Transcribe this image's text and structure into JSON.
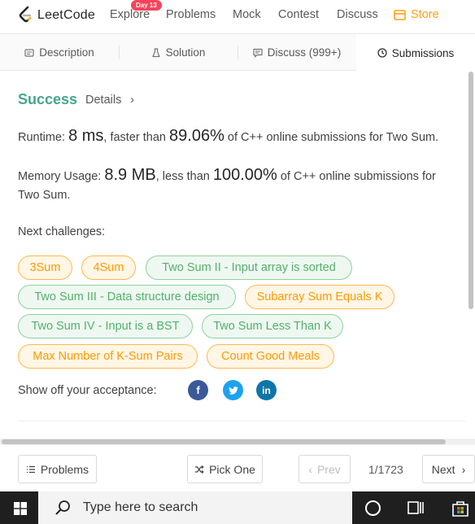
{
  "nav": {
    "logo_text": "LeetCode",
    "explore": "Explore",
    "explore_badge": "Day 13",
    "problems": "Problems",
    "mock": "Mock",
    "contest": "Contest",
    "discuss": "Discuss",
    "store": "Store",
    "accent_color": "#ffa116"
  },
  "tabs": [
    {
      "label": "Description",
      "icon": "document-icon"
    },
    {
      "label": "Solution",
      "icon": "flask-icon"
    },
    {
      "label": "Discuss (999+)",
      "icon": "comment-icon"
    },
    {
      "label": "Submissions",
      "icon": "clock-icon",
      "active": true
    }
  ],
  "result": {
    "status": "Success",
    "status_color": "#45a68c",
    "details": "Details",
    "runtime_label": "Runtime:",
    "runtime_value": "8 ms",
    "runtime_mid": ", faster than",
    "runtime_pct": "89.06%",
    "runtime_tail": "of C++ online submissions for Two Sum.",
    "memory_label": "Memory Usage:",
    "memory_value": "8.9 MB",
    "memory_mid": ", less than",
    "memory_pct": "100.00%",
    "memory_tail": "of C++ online submissions for",
    "memory_tail2": "Two Sum."
  },
  "next_challenges": {
    "label": "Next challenges:",
    "items": [
      {
        "label": "3Sum",
        "difficulty": "medium"
      },
      {
        "label": "4Sum",
        "difficulty": "medium"
      },
      {
        "label": "Two Sum II - Input array is sorted",
        "difficulty": "easy"
      },
      {
        "label": "Two Sum III - Data structure design",
        "difficulty": "easy"
      },
      {
        "label": "Subarray Sum Equals K",
        "difficulty": "medium"
      },
      {
        "label": "Two Sum IV - Input is a BST",
        "difficulty": "easy"
      },
      {
        "label": "Two Sum Less Than K",
        "difficulty": "easy"
      },
      {
        "label": "Max Number of K-Sum Pairs",
        "difficulty": "medium"
      },
      {
        "label": "Count Good Meals",
        "difficulty": "medium"
      }
    ]
  },
  "share": {
    "label": "Show off your acceptance:",
    "facebook": "f",
    "linkedin": "in"
  },
  "bottom": {
    "problems": "Problems",
    "pick_one": "Pick One",
    "prev": "Prev",
    "page": "1/1723",
    "next": "Next"
  },
  "taskbar": {
    "search_placeholder": "Type here to search"
  }
}
